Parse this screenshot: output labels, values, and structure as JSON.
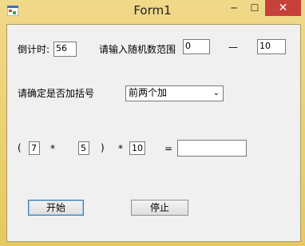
{
  "window": {
    "title": "Form1",
    "min": "─",
    "max": "☐",
    "close": "✕"
  },
  "countdown": {
    "label": "倒计时:",
    "value": "56"
  },
  "range": {
    "label": "请输入随机数范围",
    "from": "0",
    "dash": "—",
    "to": "10"
  },
  "paren": {
    "label": "请确定是否加括号",
    "selected": "前两个加"
  },
  "expr": {
    "lparen": "(",
    "a": "7",
    "op1": "*",
    "b": "5",
    "rparen": ")",
    "op2": "*",
    "c": "10",
    "eq": "=",
    "answer": ""
  },
  "buttons": {
    "start": "开始",
    "stop": "停止"
  },
  "colors": {
    "frame": "#e9cf70",
    "close": "#c8403a",
    "focus": "#3c7fb1"
  }
}
